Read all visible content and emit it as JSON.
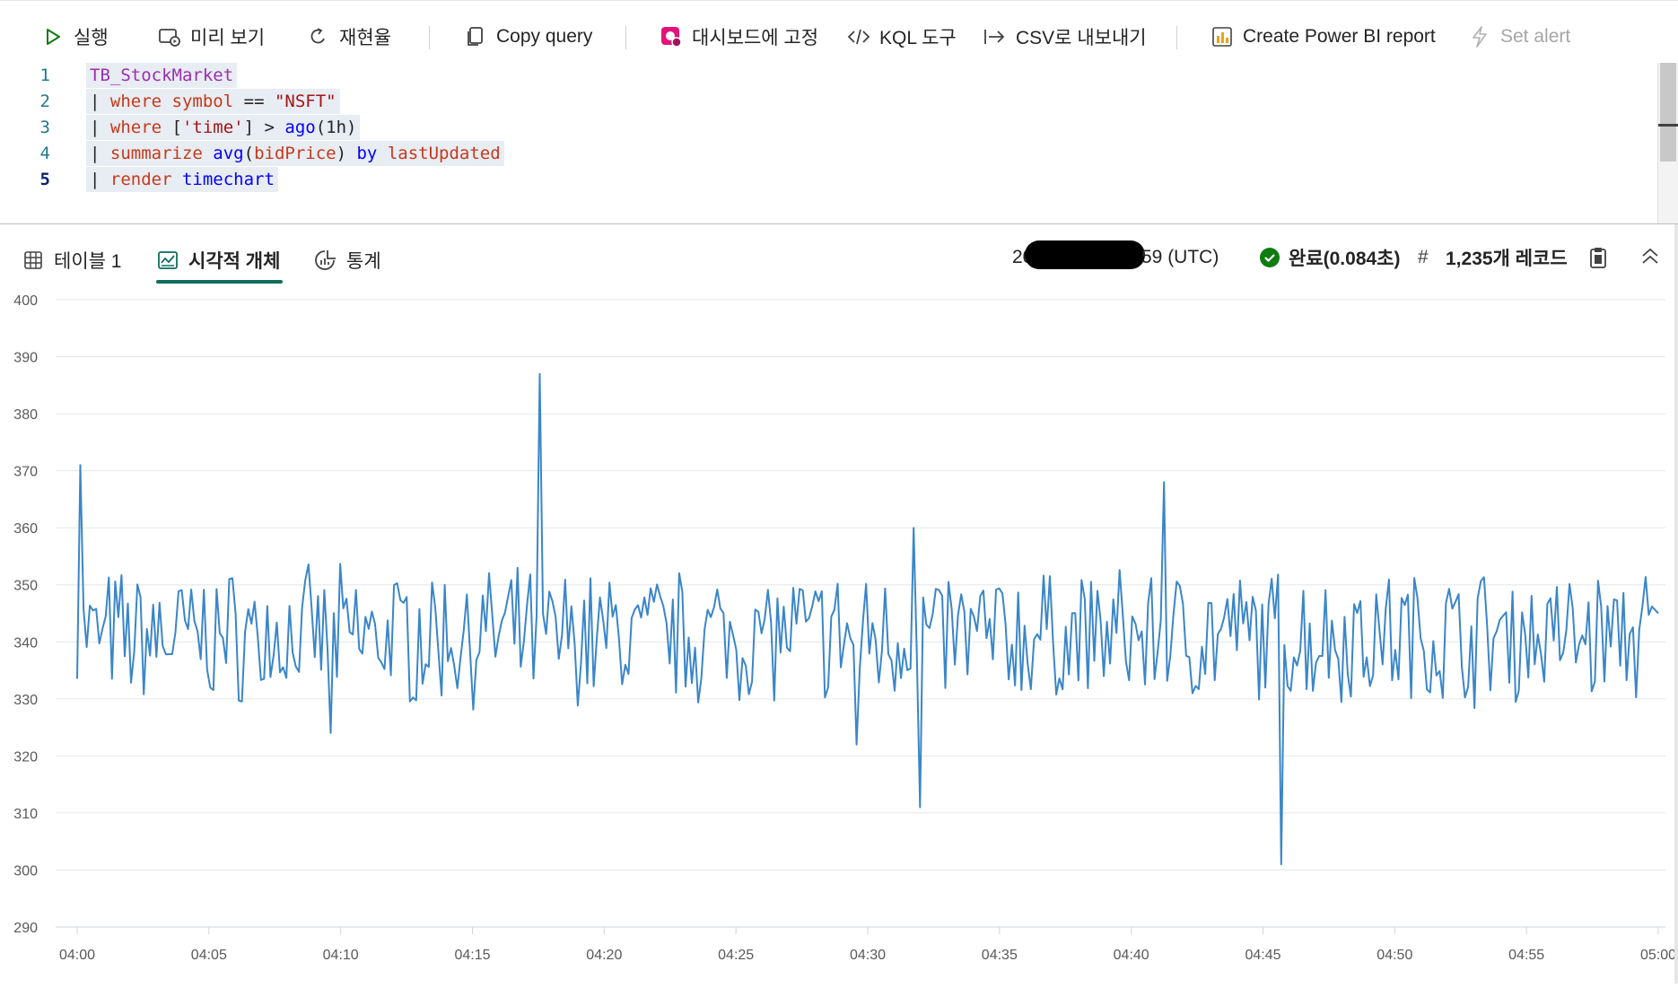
{
  "toolbar": {
    "run": "실행",
    "preview": "미리 보기",
    "recall": "재현율",
    "copy_query": "Copy query",
    "pin_dashboard": "대시보드에 고정",
    "kql_tools": "KQL 도구",
    "export_csv": "CSV로 내보내기",
    "create_powerbi": "Create Power BI report",
    "set_alert": "Set alert"
  },
  "editor": {
    "line_numbers": [
      "1",
      "2",
      "3",
      "4",
      "5"
    ],
    "lines": [
      [
        {
          "t": "TB_StockMarket",
          "c": "k-tbl"
        }
      ],
      [
        {
          "t": "| ",
          "c": "k-pun"
        },
        {
          "t": "where",
          "c": "k-op"
        },
        {
          "t": " ",
          "c": "k-pun"
        },
        {
          "t": "symbol",
          "c": "k-col"
        },
        {
          "t": " == ",
          "c": "k-pun"
        },
        {
          "t": "\"NSFT\"",
          "c": "k-str"
        }
      ],
      [
        {
          "t": "| ",
          "c": "k-pun"
        },
        {
          "t": "where",
          "c": "k-op"
        },
        {
          "t": " [",
          "c": "k-pun"
        },
        {
          "t": "'time'",
          "c": "k-str"
        },
        {
          "t": "] > ",
          "c": "k-pun"
        },
        {
          "t": "ago",
          "c": "k-fn"
        },
        {
          "t": "(1h)",
          "c": "k-pun"
        }
      ],
      [
        {
          "t": "| ",
          "c": "k-pun"
        },
        {
          "t": "summarize",
          "c": "k-op"
        },
        {
          "t": " ",
          "c": "k-pun"
        },
        {
          "t": "avg",
          "c": "k-fn"
        },
        {
          "t": "(",
          "c": "k-pun"
        },
        {
          "t": "bidPrice",
          "c": "k-col"
        },
        {
          "t": ") ",
          "c": "k-pun"
        },
        {
          "t": "by",
          "c": "k-fn"
        },
        {
          "t": " ",
          "c": "k-pun"
        },
        {
          "t": "lastUpdated",
          "c": "k-col"
        }
      ],
      [
        {
          "t": "| ",
          "c": "k-pun"
        },
        {
          "t": "render",
          "c": "k-op"
        },
        {
          "t": " ",
          "c": "k-pun"
        },
        {
          "t": "timechart",
          "c": "k-fn"
        }
      ]
    ]
  },
  "results": {
    "tab_table": "테이블 1",
    "tab_visual": "시각적 개체",
    "tab_stats": "통계",
    "timestamp_prefix": "20",
    "timestamp_suffix": "59 (UTC)",
    "status_done": "완료(0.084초)",
    "record_hash": "#",
    "record_count": "1,235개 레코드"
  },
  "colors": {
    "accent": "#0f6f5c",
    "line": "#3a86c8",
    "success": "#107c10"
  },
  "chart_data": {
    "type": "line",
    "ylim": [
      290,
      400
    ],
    "yticks": [
      290,
      300,
      310,
      320,
      330,
      340,
      350,
      360,
      370,
      380,
      390,
      400
    ],
    "xticks": [
      "04:00",
      "04:05",
      "04:10",
      "04:15",
      "04:20",
      "04:25",
      "04:30",
      "04:35",
      "04:40",
      "04:45",
      "04:50",
      "04:55",
      "05:00"
    ],
    "x_range_minutes": [
      0,
      60
    ],
    "mean": 341,
    "amplitude": 10,
    "point_count": 500,
    "spikes": [
      {
        "minute": 0.1,
        "value": 371
      },
      {
        "minute": 17.6,
        "value": 387
      },
      {
        "minute": 31.7,
        "value": 360
      },
      {
        "minute": 32.0,
        "value": 311
      },
      {
        "minute": 41.3,
        "value": 368
      },
      {
        "minute": 45.7,
        "value": 301
      },
      {
        "minute": 29.6,
        "value": 322
      },
      {
        "minute": 9.6,
        "value": 324
      }
    ],
    "grid": true
  }
}
